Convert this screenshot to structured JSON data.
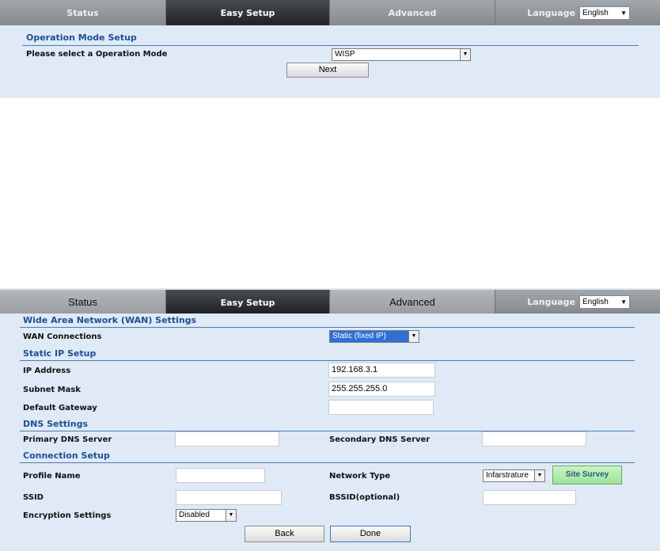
{
  "nav": {
    "status": "Status",
    "easy_setup": "Easy Setup",
    "advanced": "Advanced",
    "language_label": "Language",
    "language_value": "English"
  },
  "op_mode": {
    "title": "Operation Mode Setup",
    "select_label": "Please select a Operation Mode",
    "select_value": "WISP",
    "next_label": "Next"
  },
  "wan": {
    "title": "Wide Area Network (WAN) Settings",
    "connections_label": "WAN Connections",
    "connections_value": "Static (fixed IP)",
    "static_title": "Static IP Setup",
    "ip_label": "IP Address",
    "ip_value": "192.168.3.1",
    "mask_label": "Subnet Mask",
    "mask_value": "255.255.255.0",
    "gateway_label": "Default Gateway",
    "gateway_value": "",
    "dns_title": "DNS Settings",
    "primary_dns_label": "Primary DNS Server",
    "primary_dns_value": "",
    "secondary_dns_label": "Secondary DNS Server",
    "secondary_dns_value": "",
    "conn_title": "Connection Setup",
    "profile_label": "Profile Name",
    "profile_value": "",
    "network_type_label": "Network Type",
    "network_type_value": "Infarstrature",
    "site_survey_label": "Site Survey",
    "ssid_label": "SSID",
    "ssid_value": "",
    "bssid_label": "BSSID(optional)",
    "bssid_value": "",
    "encryption_label": "Encryption Settings",
    "encryption_value": "Disabled",
    "back_label": "Back",
    "done_label": "Done"
  }
}
